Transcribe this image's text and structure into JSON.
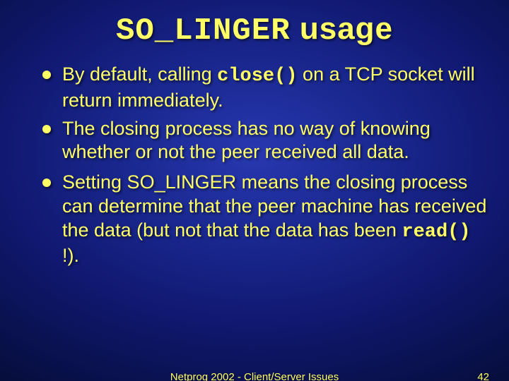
{
  "title": {
    "code": "SO_LINGER",
    "rest": " usage"
  },
  "bullets": [
    {
      "pre": "By default, calling ",
      "code": "close()",
      "post": " on a TCP socket will return immediately."
    },
    {
      "pre": "The closing process has no way of knowing whether or not the peer received all data.",
      "code": "",
      "post": ""
    },
    {
      "pre": "Setting SO_LINGER means the closing process can determine that the peer machine has received the data (but not that the data has been ",
      "code": "read()",
      "post": " !)."
    }
  ],
  "footer": {
    "center": "Netprog 2002 - Client/Server Issues",
    "page": "42"
  }
}
